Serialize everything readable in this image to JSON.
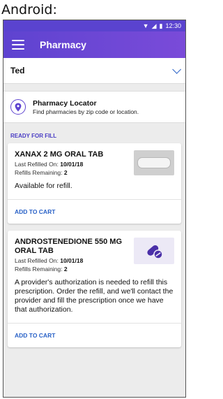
{
  "caption": "Android:",
  "status_bar": {
    "time": "12:30"
  },
  "app_bar": {
    "title": "Pharmacy"
  },
  "patient": {
    "name": "Ted"
  },
  "locator": {
    "title": "Pharmacy Locator",
    "subtitle": "Find pharmacies by zip code or location."
  },
  "section_label": "READY FOR FILL",
  "cards": [
    {
      "drug": "XANAX 2 MG ORAL TAB",
      "last_refilled_label": "Last Refilled On:",
      "last_refilled": "10/01/18",
      "refills_label": "Refills Remaining:",
      "refills": "2",
      "description": "Available for refill.",
      "action": "ADD TO CART"
    },
    {
      "drug": "ANDROSTENEDIONE 550 MG ORAL TAB",
      "last_refilled_label": "Last Refilled On:",
      "last_refilled": "10/01/18",
      "refills_label": "Refills Remaining:",
      "refills": "2",
      "description": "A provider's authorization is needed to refill this prescription. Order the refill, and we'll contact the provider and fill the prescription once we have that authorization.",
      "action": "ADD TO CART"
    }
  ],
  "colors": {
    "primary": "#5e43d0",
    "link": "#2a62c7"
  }
}
